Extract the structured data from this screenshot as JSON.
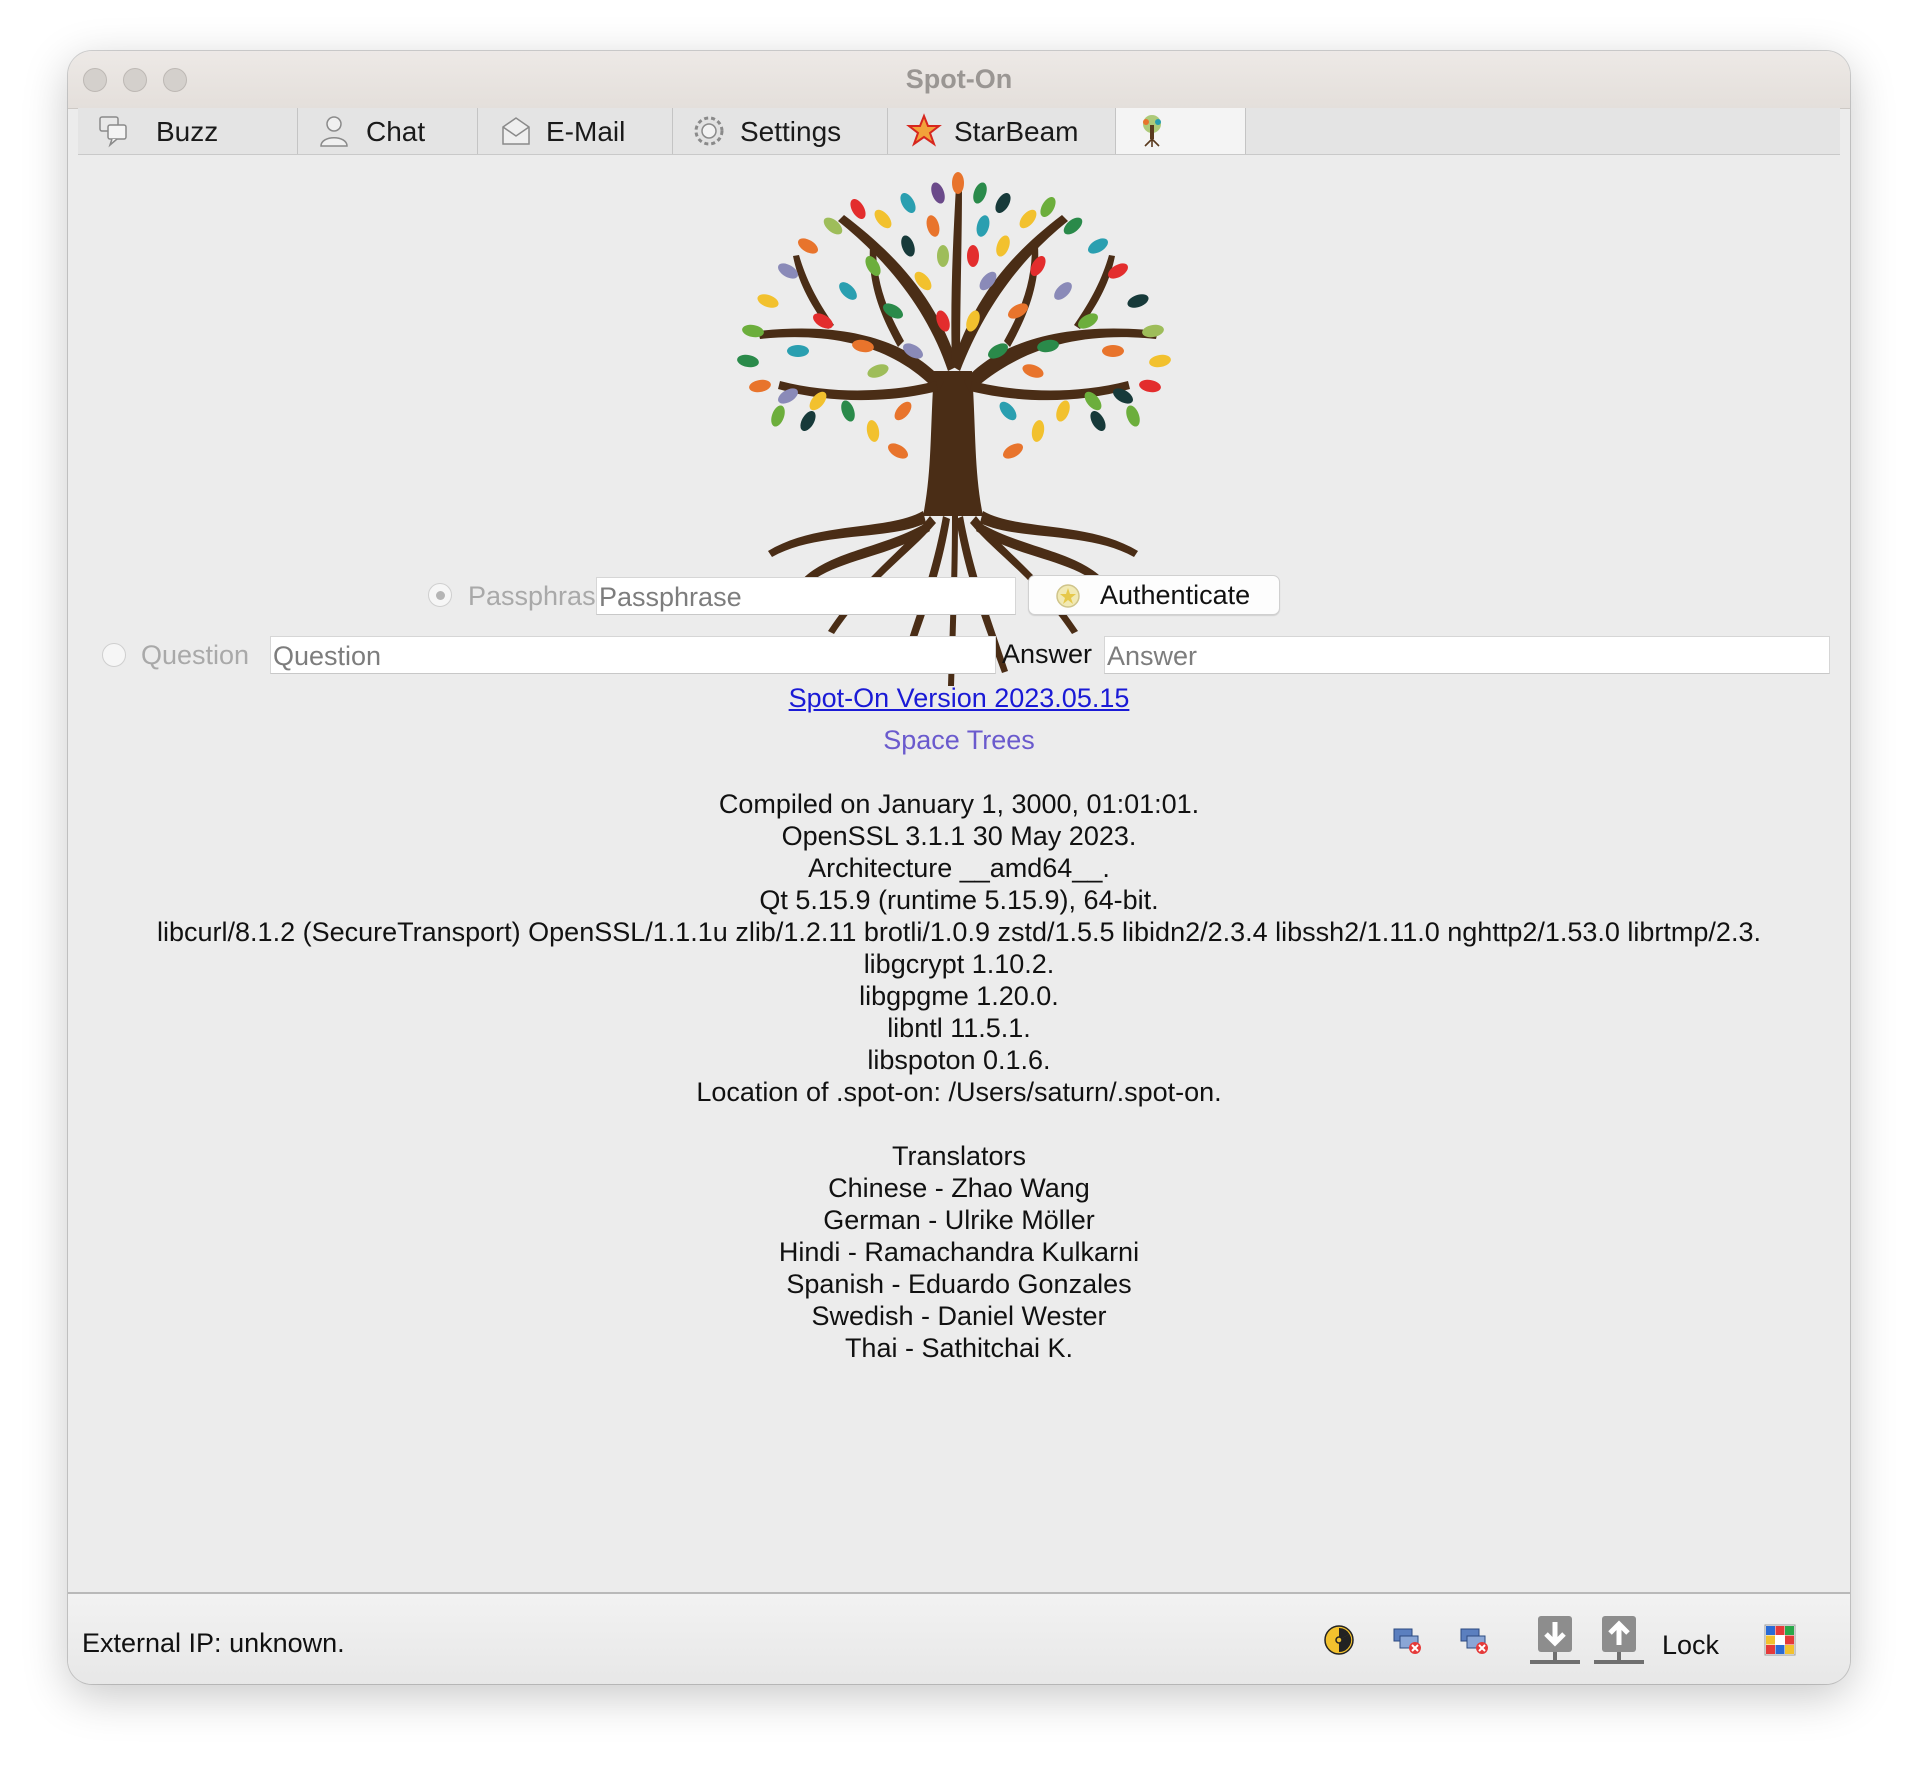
{
  "window": {
    "title": "Spot-On"
  },
  "tabs": [
    {
      "label": "Buzz",
      "icon": "buzz-icon"
    },
    {
      "label": "Chat",
      "icon": "person-icon"
    },
    {
      "label": "E-Mail",
      "icon": "envelope-icon"
    },
    {
      "label": "Settings",
      "icon": "gear-icon"
    },
    {
      "label": "StarBeam",
      "icon": "star-icon"
    },
    {
      "label": "",
      "icon": "tree-icon"
    }
  ],
  "auth": {
    "passphrase_radio_label": "Passphrase",
    "passphrase_placeholder": "Passphrase",
    "authenticate_label": "Authenticate",
    "question_radio_label": "Question",
    "question_placeholder": "Question",
    "answer_label": "Answer",
    "answer_placeholder": "Answer"
  },
  "about": {
    "version_link": "Spot-On Version 2023.05.15",
    "codename": "Space Trees",
    "build_lines": [
      "Compiled on January 1, 3000, 01:01:01.",
      "OpenSSL 3.1.1 30 May 2023.",
      "Architecture __amd64__.",
      "Qt 5.15.9 (runtime 5.15.9), 64-bit.",
      "libcurl/8.1.2 (SecureTransport) OpenSSL/1.1.1u zlib/1.2.11 brotli/1.0.9 zstd/1.5.5 libidn2/2.3.4 libssh2/1.11.0 nghttp2/1.53.0 librtmp/2.3.",
      "libgcrypt 1.10.2.",
      "libgpgme 1.20.0.",
      "libntl 11.5.1.",
      "libspoton 0.1.6.",
      "Location of .spot-on: /Users/saturn/.spot-on."
    ],
    "translators_heading": "Translators",
    "translators": [
      "Chinese - Zhao Wang",
      "German - Ulrike Möller",
      "Hindi - Ramachandra Kulkarni",
      "Spanish - Eduardo Gonzales",
      "Swedish - Daniel Wester",
      "Thai - Sathitchai K."
    ]
  },
  "status": {
    "external_ip": "External IP: unknown.",
    "lock_label": "Lock",
    "icons": [
      "radiation-icon",
      "neighbors-disconnected-icon",
      "listeners-disconnected-icon",
      "download-icon",
      "upload-icon",
      "pop-a-tic-icon"
    ]
  },
  "colors": {
    "link": "#1a1ad6",
    "codename": "#6a5acd",
    "window_bg": "#ececec"
  }
}
